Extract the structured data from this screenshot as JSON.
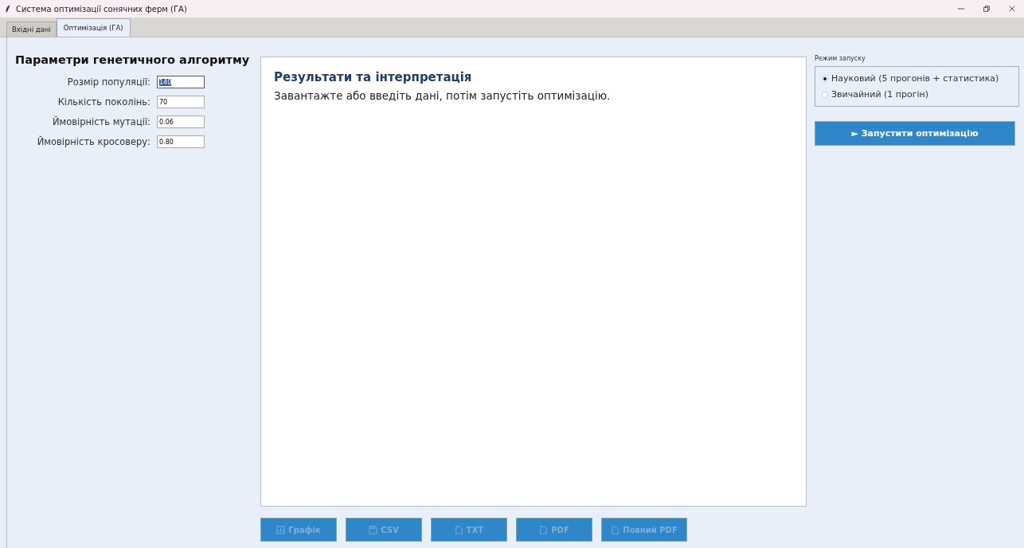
{
  "window": {
    "title": "Система оптимізації сонячних ферм (ГА)"
  },
  "tabs": [
    {
      "label": "Вхідні дані",
      "selected": false
    },
    {
      "label": "Оптимізація (ГА)",
      "selected": true
    }
  ],
  "parameters": {
    "title": "Параметри генетичного алгоритму",
    "fields": [
      {
        "label": "Розмір популяції:",
        "value": "140",
        "text_selected": true
      },
      {
        "label": "Кількість поколінь:",
        "value": "70",
        "text_selected": false
      },
      {
        "label": "Ймовірність мутації:",
        "value": "0.06",
        "text_selected": false
      },
      {
        "label": "Ймовірність кросоверу:",
        "value": "0.80",
        "text_selected": false
      }
    ]
  },
  "results": {
    "title": "Результати та інтерпретація",
    "text": "Завантажте або введіть дані, потім запустіть оптимізацію."
  },
  "export_buttons": [
    {
      "label": "Графік",
      "kind": "chart",
      "disabled": true
    },
    {
      "label": "CSV",
      "kind": "save",
      "disabled": true
    },
    {
      "label": "TXT",
      "kind": "doc",
      "disabled": true
    },
    {
      "label": "PDF",
      "kind": "doc",
      "disabled": true
    },
    {
      "label": "Повний PDF",
      "kind": "doc",
      "disabled": true
    }
  ],
  "run_mode": {
    "title": "Режим запуску",
    "options": [
      {
        "label": "Науковий (5 прогонів + статистика)",
        "selected": true
      },
      {
        "label": "Звичайний (1 прогін)",
        "selected": false
      }
    ]
  },
  "run_button": {
    "label": "► Запустити оптимізацію"
  }
}
